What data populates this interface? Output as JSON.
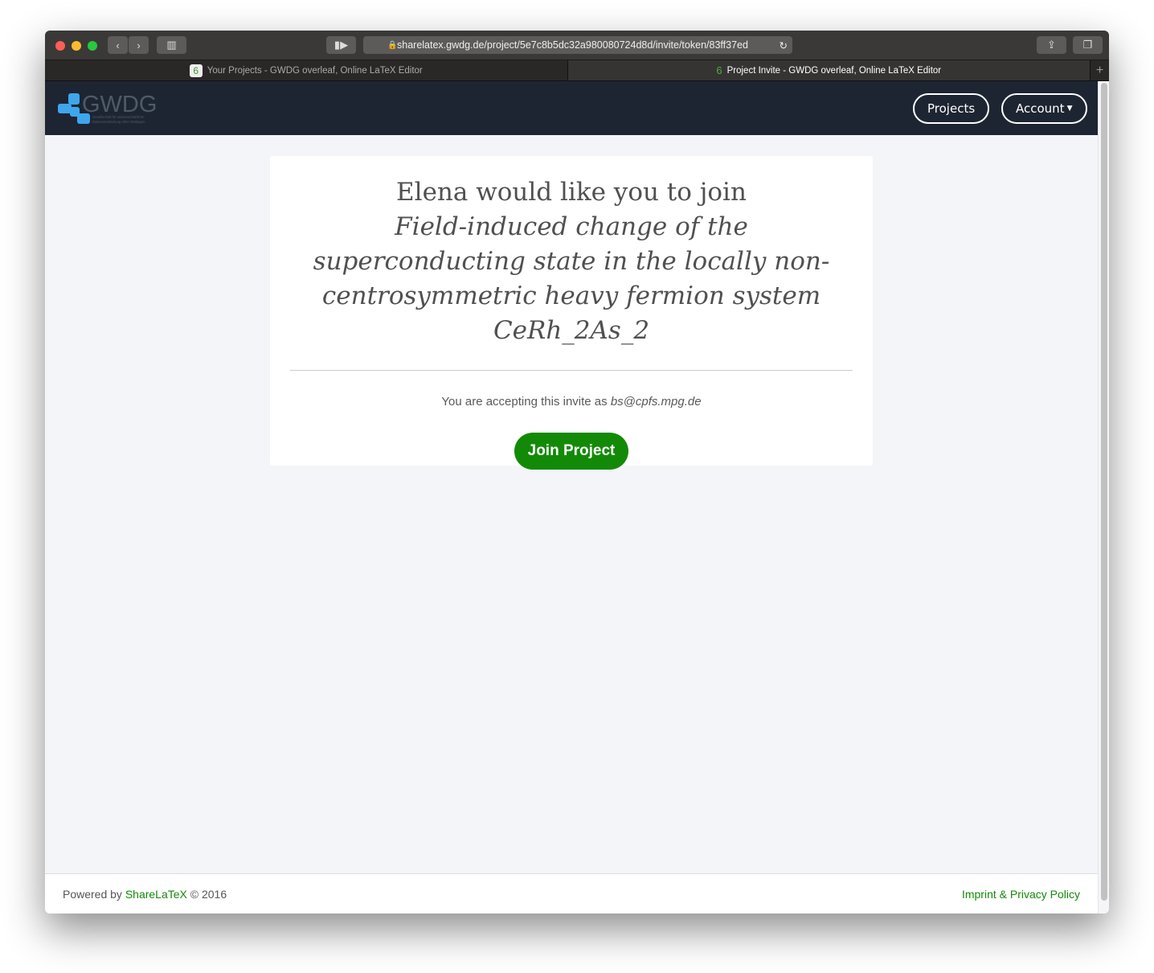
{
  "browser": {
    "url": "sharelatex.gwdg.de/project/5e7c8b5dc32a980080724d8d/invite/token/83ff37ed",
    "tabs": [
      {
        "title": "Your Projects - GWDG overleaf, Online LaTeX Editor",
        "active": false
      },
      {
        "title": "Project Invite - GWDG overleaf, Online LaTeX Editor",
        "active": true
      }
    ]
  },
  "navbar": {
    "logo_text": "GWDG",
    "logo_subtext": "Gesellschaft für wissenschaftliche Datenverarbeitung mbH Göttingen",
    "projects_label": "Projects",
    "account_label": "Account"
  },
  "invite": {
    "heading": "Elena would like you to join",
    "project_title": "Field-induced change of the superconducting state in the locally non-centrosymmetric heavy fermion system CeRh_2As_2",
    "accepting_prefix": "You are accepting this invite as",
    "email": "bs@cpfs.mpg.de",
    "join_label": "Join Project"
  },
  "footer": {
    "powered_by": "Powered by",
    "sharelatex": "ShareLaTeX",
    "copyright": "© 2016",
    "imprint": "Imprint & Privacy Policy"
  },
  "colors": {
    "accent": "#138a07",
    "navbar": "#1e2532",
    "logo_blue": "#3ea6ec"
  }
}
